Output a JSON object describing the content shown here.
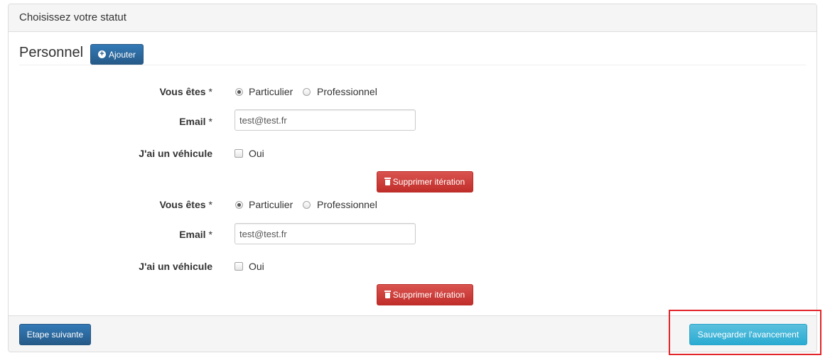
{
  "panel": {
    "title": "Choisissez votre statut"
  },
  "section": {
    "title": "Personnel",
    "add_button_label": "Ajouter",
    "add_icon": "plus-circle-icon"
  },
  "iterations": [
    {
      "status_label": "Vous êtes",
      "status_required": "*",
      "status_options": [
        "Particulier",
        "Professionnel"
      ],
      "status_selected": "Particulier",
      "email_label": "Email",
      "email_required": "*",
      "email_value": "test@test.fr",
      "vehicle_label": "J'ai un véhicule",
      "vehicle_option": "Oui",
      "vehicle_checked": false,
      "delete_button_label": "Supprimer itération",
      "delete_icon": "trash-icon"
    },
    {
      "status_label": "Vous êtes",
      "status_required": "*",
      "status_options": [
        "Particulier",
        "Professionnel"
      ],
      "status_selected": "Particulier",
      "email_label": "Email",
      "email_required": "*",
      "email_value": "test@test.fr",
      "vehicle_label": "J'ai un véhicule",
      "vehicle_option": "Oui",
      "vehicle_checked": false,
      "delete_button_label": "Supprimer itération",
      "delete_icon": "trash-icon"
    }
  ],
  "footer": {
    "next_button_label": "Etape suivante",
    "save_button_label": "Sauvegarder l'avancement"
  },
  "colors": {
    "primary": "#337ab7",
    "danger": "#d9534f",
    "info": "#5bc0de",
    "highlight": "#e3242b"
  }
}
